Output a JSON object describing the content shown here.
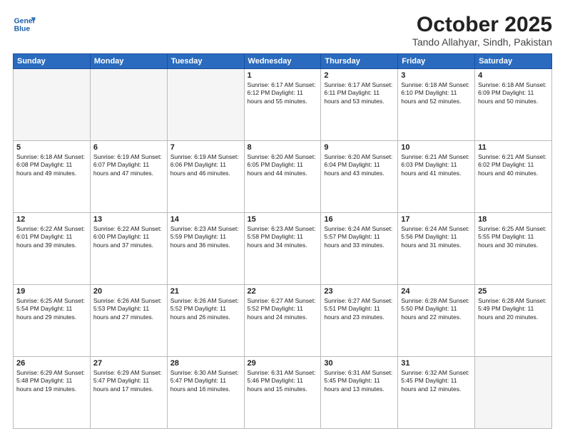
{
  "header": {
    "logo_line1": "General",
    "logo_line2": "Blue",
    "month": "October 2025",
    "location": "Tando Allahyar, Sindh, Pakistan"
  },
  "weekdays": [
    "Sunday",
    "Monday",
    "Tuesday",
    "Wednesday",
    "Thursday",
    "Friday",
    "Saturday"
  ],
  "weeks": [
    [
      {
        "day": "",
        "text": ""
      },
      {
        "day": "",
        "text": ""
      },
      {
        "day": "",
        "text": ""
      },
      {
        "day": "1",
        "text": "Sunrise: 6:17 AM\nSunset: 6:12 PM\nDaylight: 11 hours\nand 55 minutes."
      },
      {
        "day": "2",
        "text": "Sunrise: 6:17 AM\nSunset: 6:11 PM\nDaylight: 11 hours\nand 53 minutes."
      },
      {
        "day": "3",
        "text": "Sunrise: 6:18 AM\nSunset: 6:10 PM\nDaylight: 11 hours\nand 52 minutes."
      },
      {
        "day": "4",
        "text": "Sunrise: 6:18 AM\nSunset: 6:09 PM\nDaylight: 11 hours\nand 50 minutes."
      }
    ],
    [
      {
        "day": "5",
        "text": "Sunrise: 6:18 AM\nSunset: 6:08 PM\nDaylight: 11 hours\nand 49 minutes."
      },
      {
        "day": "6",
        "text": "Sunrise: 6:19 AM\nSunset: 6:07 PM\nDaylight: 11 hours\nand 47 minutes."
      },
      {
        "day": "7",
        "text": "Sunrise: 6:19 AM\nSunset: 6:06 PM\nDaylight: 11 hours\nand 46 minutes."
      },
      {
        "day": "8",
        "text": "Sunrise: 6:20 AM\nSunset: 6:05 PM\nDaylight: 11 hours\nand 44 minutes."
      },
      {
        "day": "9",
        "text": "Sunrise: 6:20 AM\nSunset: 6:04 PM\nDaylight: 11 hours\nand 43 minutes."
      },
      {
        "day": "10",
        "text": "Sunrise: 6:21 AM\nSunset: 6:03 PM\nDaylight: 11 hours\nand 41 minutes."
      },
      {
        "day": "11",
        "text": "Sunrise: 6:21 AM\nSunset: 6:02 PM\nDaylight: 11 hours\nand 40 minutes."
      }
    ],
    [
      {
        "day": "12",
        "text": "Sunrise: 6:22 AM\nSunset: 6:01 PM\nDaylight: 11 hours\nand 39 minutes."
      },
      {
        "day": "13",
        "text": "Sunrise: 6:22 AM\nSunset: 6:00 PM\nDaylight: 11 hours\nand 37 minutes."
      },
      {
        "day": "14",
        "text": "Sunrise: 6:23 AM\nSunset: 5:59 PM\nDaylight: 11 hours\nand 36 minutes."
      },
      {
        "day": "15",
        "text": "Sunrise: 6:23 AM\nSunset: 5:58 PM\nDaylight: 11 hours\nand 34 minutes."
      },
      {
        "day": "16",
        "text": "Sunrise: 6:24 AM\nSunset: 5:57 PM\nDaylight: 11 hours\nand 33 minutes."
      },
      {
        "day": "17",
        "text": "Sunrise: 6:24 AM\nSunset: 5:56 PM\nDaylight: 11 hours\nand 31 minutes."
      },
      {
        "day": "18",
        "text": "Sunrise: 6:25 AM\nSunset: 5:55 PM\nDaylight: 11 hours\nand 30 minutes."
      }
    ],
    [
      {
        "day": "19",
        "text": "Sunrise: 6:25 AM\nSunset: 5:54 PM\nDaylight: 11 hours\nand 29 minutes."
      },
      {
        "day": "20",
        "text": "Sunrise: 6:26 AM\nSunset: 5:53 PM\nDaylight: 11 hours\nand 27 minutes."
      },
      {
        "day": "21",
        "text": "Sunrise: 6:26 AM\nSunset: 5:52 PM\nDaylight: 11 hours\nand 26 minutes."
      },
      {
        "day": "22",
        "text": "Sunrise: 6:27 AM\nSunset: 5:52 PM\nDaylight: 11 hours\nand 24 minutes."
      },
      {
        "day": "23",
        "text": "Sunrise: 6:27 AM\nSunset: 5:51 PM\nDaylight: 11 hours\nand 23 minutes."
      },
      {
        "day": "24",
        "text": "Sunrise: 6:28 AM\nSunset: 5:50 PM\nDaylight: 11 hours\nand 22 minutes."
      },
      {
        "day": "25",
        "text": "Sunrise: 6:28 AM\nSunset: 5:49 PM\nDaylight: 11 hours\nand 20 minutes."
      }
    ],
    [
      {
        "day": "26",
        "text": "Sunrise: 6:29 AM\nSunset: 5:48 PM\nDaylight: 11 hours\nand 19 minutes."
      },
      {
        "day": "27",
        "text": "Sunrise: 6:29 AM\nSunset: 5:47 PM\nDaylight: 11 hours\nand 17 minutes."
      },
      {
        "day": "28",
        "text": "Sunrise: 6:30 AM\nSunset: 5:47 PM\nDaylight: 11 hours\nand 16 minutes."
      },
      {
        "day": "29",
        "text": "Sunrise: 6:31 AM\nSunset: 5:46 PM\nDaylight: 11 hours\nand 15 minutes."
      },
      {
        "day": "30",
        "text": "Sunrise: 6:31 AM\nSunset: 5:45 PM\nDaylight: 11 hours\nand 13 minutes."
      },
      {
        "day": "31",
        "text": "Sunrise: 6:32 AM\nSunset: 5:45 PM\nDaylight: 11 hours\nand 12 minutes."
      },
      {
        "day": "",
        "text": ""
      }
    ]
  ]
}
